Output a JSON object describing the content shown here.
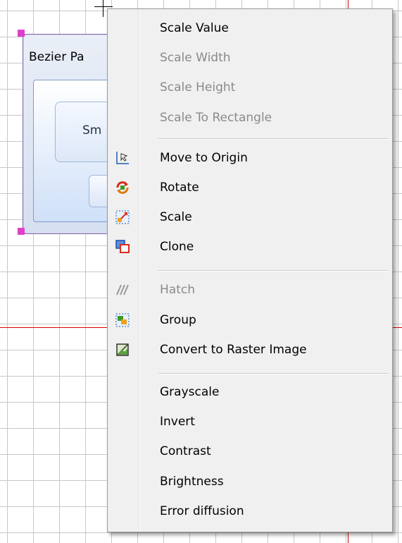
{
  "background": {
    "shape_title": "Bezier Pa",
    "shape_button_text": "Sm"
  },
  "menu": {
    "items": [
      {
        "label": "Scale Value",
        "enabled": true
      },
      {
        "label": "Scale Width",
        "enabled": false
      },
      {
        "label": "Scale Height",
        "enabled": false
      },
      {
        "label": "Scale To Rectangle",
        "enabled": false
      },
      {
        "label": "Move to Origin",
        "enabled": true,
        "icon": "move-to-origin-icon"
      },
      {
        "label": "Rotate",
        "enabled": true,
        "icon": "rotate-icon"
      },
      {
        "label": "Scale",
        "enabled": true,
        "icon": "scale-icon"
      },
      {
        "label": "Clone",
        "enabled": true,
        "icon": "clone-icon"
      },
      {
        "label": "Hatch",
        "enabled": false,
        "icon": "hatch-icon"
      },
      {
        "label": "Group",
        "enabled": true,
        "icon": "group-icon"
      },
      {
        "label": "Convert to Raster Image",
        "enabled": true,
        "icon": "raster-image-icon"
      },
      {
        "label": "Grayscale",
        "enabled": true
      },
      {
        "label": "Invert",
        "enabled": true
      },
      {
        "label": "Contrast",
        "enabled": true
      },
      {
        "label": "Brightness",
        "enabled": true
      },
      {
        "label": "Error diffusion",
        "enabled": true
      }
    ]
  },
  "colors": {
    "grid": "#c8c8c8",
    "guide_line": "#e00000",
    "selection_handle": "#e040c8",
    "menu_background": "#f0f0f0",
    "disabled_text": "#8a8a8a"
  }
}
